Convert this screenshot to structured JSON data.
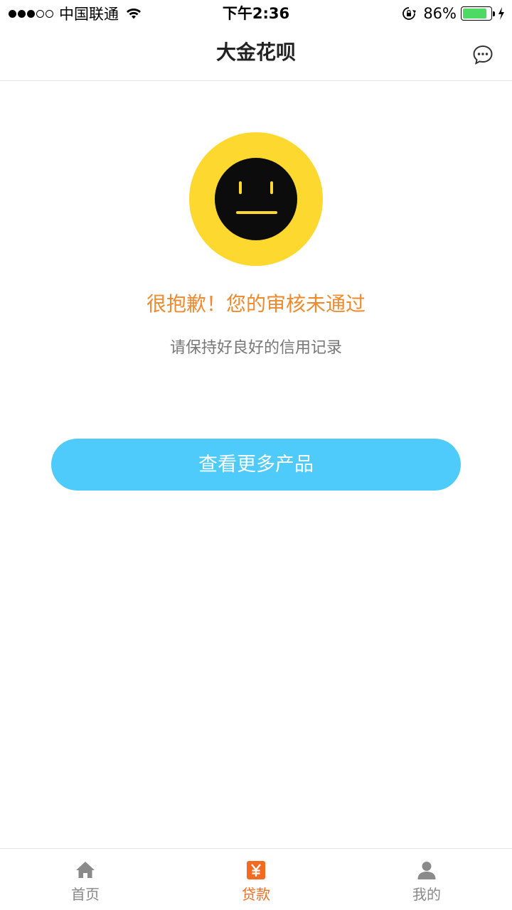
{
  "status_bar": {
    "carrier": "中国联通",
    "time": "下午2:36",
    "battery": "86%",
    "battery_level": 0.86
  },
  "nav": {
    "title": "大金花呗",
    "message_icon": "chat-bubble-icon"
  },
  "result": {
    "icon": "neutral-face-icon",
    "title": "很抱歉！您的审核未通过",
    "subtitle": "请保持好良好的信用记录",
    "button_label": "查看更多产品"
  },
  "tabs": [
    {
      "label": "首页",
      "icon": "home-icon",
      "active": false
    },
    {
      "label": "贷款",
      "icon": "yuan-icon",
      "active": true
    },
    {
      "label": "我的",
      "icon": "user-icon",
      "active": false
    }
  ],
  "colors": {
    "accent_orange": "#ef8a2f",
    "button_blue": "#4ecbfb",
    "face_yellow": "#fdd82e",
    "tab_active": "#f26b21"
  }
}
